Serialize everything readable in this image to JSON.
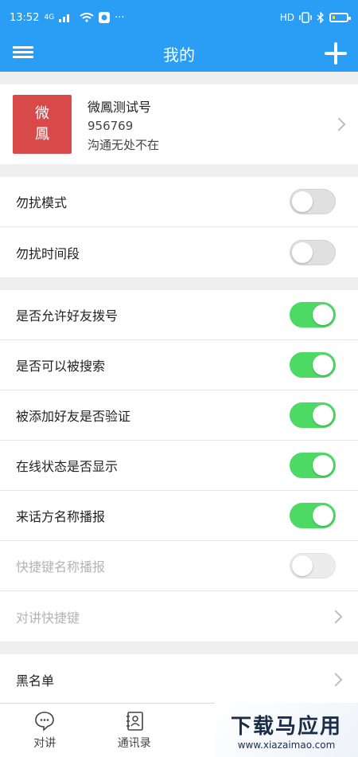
{
  "status": {
    "time": "13:52",
    "network": "4G",
    "hd": "HD",
    "battery_level": 0.2
  },
  "header": {
    "title": "我的"
  },
  "profile": {
    "avatar_line1": "微",
    "avatar_line2": "鳳",
    "avatar_color": "#d84a4a",
    "name": "微鳳测试号",
    "id": "956769",
    "signature": "沟通无处不在"
  },
  "group1": [
    {
      "label": "勿扰模式",
      "on": false
    },
    {
      "label": "勿扰时间段",
      "on": false
    }
  ],
  "group2": [
    {
      "label": "是否允许好友拨号",
      "on": true
    },
    {
      "label": "是否可以被搜索",
      "on": true
    },
    {
      "label": "被添加好友是否验证",
      "on": true
    },
    {
      "label": "在线状态是否显示",
      "on": true
    },
    {
      "label": "来话方名称播报",
      "on": true
    },
    {
      "label": "快捷键名称播报",
      "on": false,
      "disabled": true
    },
    {
      "label": "对讲快捷键",
      "disabled": true
    }
  ],
  "group3": [
    {
      "label": "黑名单"
    }
  ],
  "tabs": [
    {
      "label": "对讲",
      "icon": "chat-bubble-icon"
    },
    {
      "label": "通讯录",
      "icon": "contacts-icon"
    }
  ],
  "watermark": {
    "title": "下载马应用",
    "url": "www.xiazaimao.com"
  },
  "colors": {
    "primary": "#2a9df4",
    "toggle_on": "#4cd964"
  }
}
